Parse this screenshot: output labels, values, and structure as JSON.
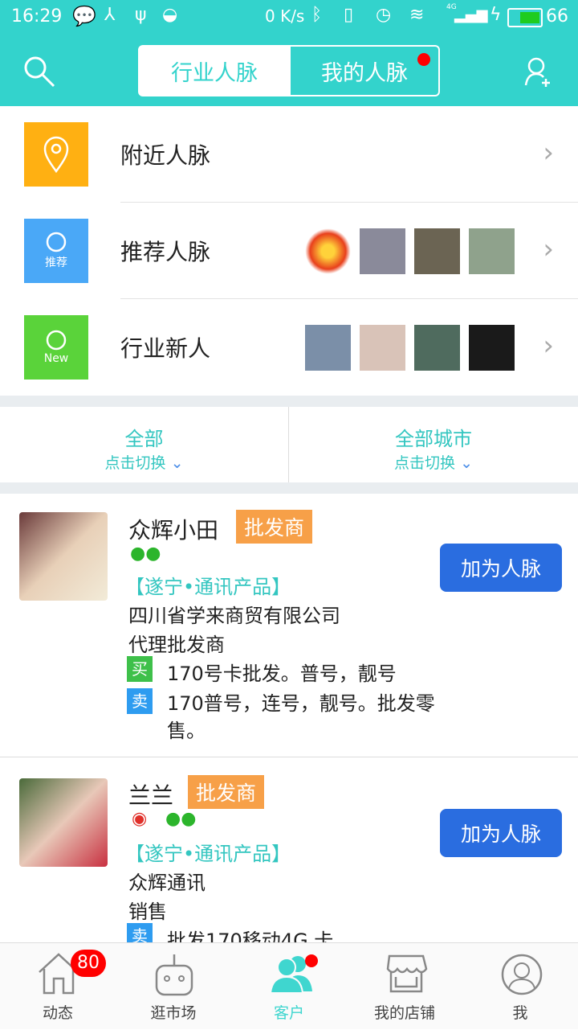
{
  "status_bar": {
    "time": "16:29",
    "net_speed": "0 K/s",
    "battery": "66",
    "network": "4G"
  },
  "header": {
    "tabs": [
      {
        "label": "行业人脉",
        "active": true
      },
      {
        "label": "我的人脉",
        "active": false,
        "dot": true
      }
    ]
  },
  "menu": [
    {
      "label": "附近人脉",
      "icon": "location-pin-icon",
      "color": "#ffb012"
    },
    {
      "label": "推荐人脉",
      "icon": "recommend-user-icon",
      "icon_text": "推荐",
      "color": "#4aa8f7"
    },
    {
      "label": "行业新人",
      "icon": "new-user-icon",
      "icon_text": "New",
      "color": "#5ad33a"
    }
  ],
  "filters": [
    {
      "title": "全部",
      "sub": "点击切换"
    },
    {
      "title": "全部城市",
      "sub": "点击切换"
    }
  ],
  "contacts": [
    {
      "name": "众辉小田",
      "tag": "批发商",
      "location": "【遂宁•通讯产品】",
      "company": "四川省学来商贸有限公司",
      "role": "代理批发商",
      "buy_label": "买",
      "buy": "170号卡批发。普号，靓号",
      "sell_label": "卖",
      "sell": "170普号，连号，靓号。批发零售。",
      "button": "加为人脉"
    },
    {
      "name": "兰兰",
      "tag": "批发商",
      "location": "【遂宁•通讯产品】",
      "company": "众辉通讯",
      "role": "销售",
      "sell_label": "卖",
      "sell": "批发170移动4G 卡",
      "button": "加为人脉"
    }
  ],
  "nav": [
    {
      "label": "动态",
      "badge": "80"
    },
    {
      "label": "逛市场"
    },
    {
      "label": "客户",
      "active": true,
      "dot": true
    },
    {
      "label": "我的店铺"
    },
    {
      "label": "我"
    }
  ],
  "colors": {
    "primary": "#33d3cc",
    "button": "#2a6de0",
    "tag": "#f7a048",
    "badge": "#ff0000"
  }
}
